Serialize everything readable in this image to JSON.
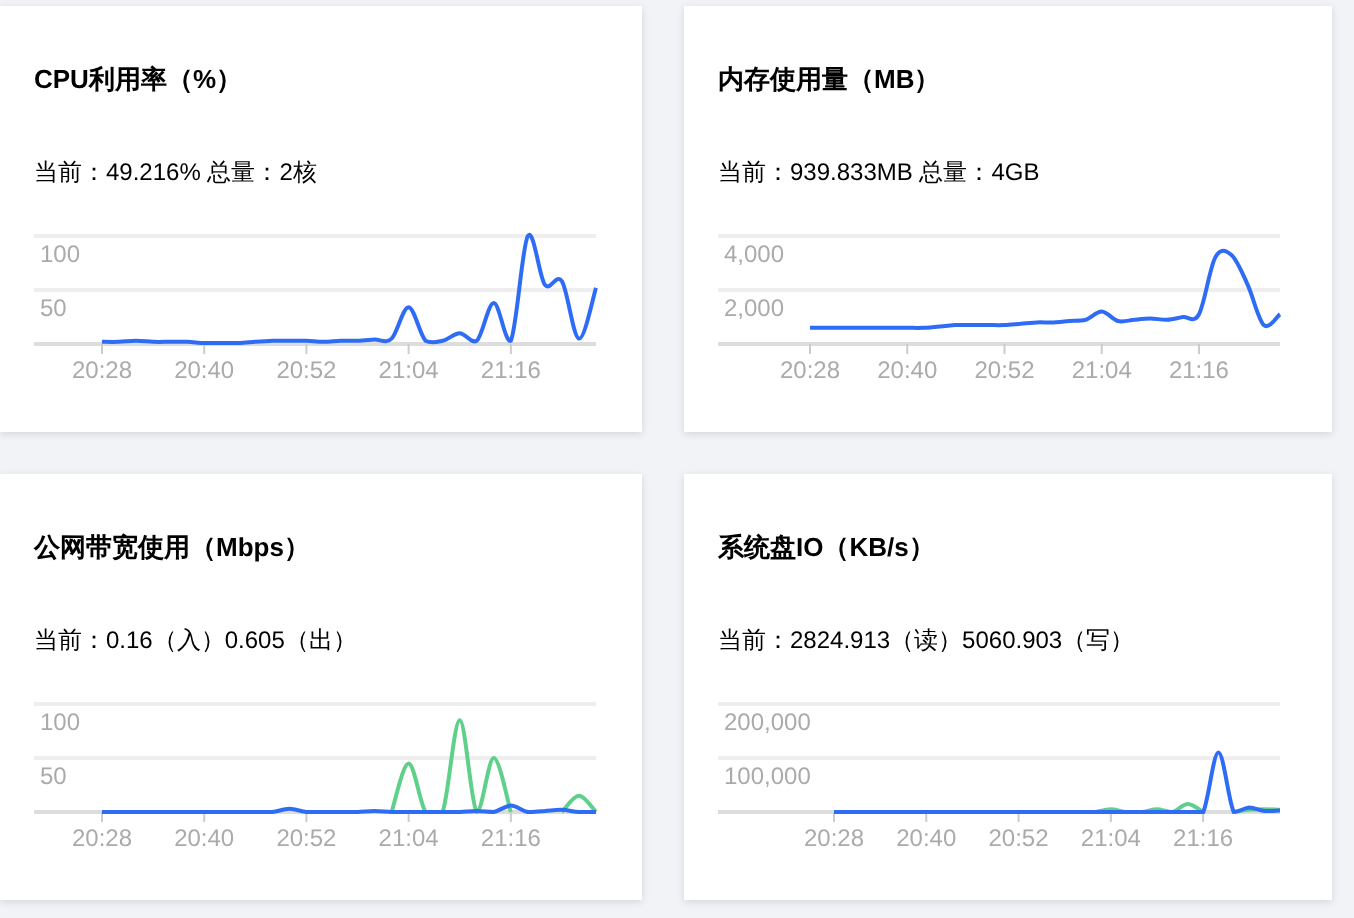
{
  "cards": [
    {
      "title": "CPU利用率（%）",
      "summary": "当前：49.216% 总量：2核",
      "chart_data": {
        "type": "line",
        "categories": [
          "20:28",
          null,
          null,
          null,
          null,
          null,
          "20:40",
          null,
          null,
          null,
          null,
          null,
          "20:52",
          null,
          null,
          null,
          null,
          null,
          "21:04",
          null,
          null,
          null,
          null,
          null,
          "21:16",
          null,
          null,
          null,
          null,
          null
        ],
        "ylim": [
          0,
          100
        ],
        "yticks": [
          {
            "value": 50,
            "label": "50"
          },
          {
            "value": 100,
            "label": "100"
          }
        ],
        "series": [
          {
            "color": "#2e6cf6",
            "values": [
              2,
              2,
              3,
              2,
              2,
              2,
              1,
              1,
              1,
              2,
              3,
              3,
              3,
              2,
              3,
              3,
              4,
              5,
              34,
              3,
              3,
              10,
              3,
              38,
              3,
              100,
              55,
              58,
              5,
              52
            ]
          }
        ]
      }
    },
    {
      "title": "内存使用量（MB）",
      "summary": "当前：939.833MB 总量：4GB",
      "chart_data": {
        "type": "line",
        "categories": [
          "20:28",
          null,
          null,
          null,
          null,
          null,
          "20:40",
          null,
          null,
          null,
          null,
          null,
          "20:52",
          null,
          null,
          null,
          null,
          null,
          "21:04",
          null,
          null,
          null,
          null,
          null,
          "21:16",
          null,
          null,
          null,
          null,
          null
        ],
        "ylim": [
          0,
          4000
        ],
        "yticks": [
          {
            "value": 2000,
            "label": "2,000"
          },
          {
            "value": 4000,
            "label": "4,000"
          }
        ],
        "series": [
          {
            "color": "#2e6cf6",
            "values": [
              600,
              600,
              600,
              600,
              600,
              600,
              600,
              600,
              650,
              700,
              700,
              700,
              700,
              750,
              800,
              800,
              850,
              900,
              1200,
              850,
              900,
              950,
              900,
              1000,
              1100,
              3200,
              3300,
              2200,
              700,
              1100
            ]
          }
        ]
      }
    },
    {
      "title": "公网带宽使用（Mbps）",
      "summary": "当前：0.16（入）0.605（出）",
      "chart_data": {
        "type": "line",
        "categories": [
          "20:28",
          null,
          null,
          null,
          null,
          null,
          "20:40",
          null,
          null,
          null,
          null,
          null,
          "20:52",
          null,
          null,
          null,
          null,
          null,
          "21:04",
          null,
          null,
          null,
          null,
          null,
          "21:16",
          null,
          null,
          null,
          null,
          null
        ],
        "ylim": [
          0,
          100
        ],
        "yticks": [
          {
            "value": 50,
            "label": "50"
          },
          {
            "value": 100,
            "label": "100"
          }
        ],
        "series": [
          {
            "color": "#5fd08a",
            "values": [
              null,
              null,
              null,
              null,
              null,
              null,
              null,
              null,
              null,
              null,
              null,
              null,
              null,
              null,
              null,
              null,
              null,
              0,
              45,
              0,
              0,
              85,
              0,
              50,
              0,
              null,
              null,
              0,
              15,
              0
            ]
          },
          {
            "color": "#2e6cf6",
            "values": [
              0,
              0,
              0,
              0,
              0,
              0,
              0,
              0,
              0,
              0,
              0,
              3,
              0,
              0,
              0,
              0,
              1,
              0,
              0,
              0,
              0,
              0,
              1,
              0,
              6,
              0,
              1,
              2,
              0,
              0
            ]
          }
        ]
      }
    },
    {
      "title": "系统盘IO（KB/s）",
      "summary": "当前：2824.913（读）5060.903（写）",
      "chart_data": {
        "type": "line",
        "categories": [
          "20:28",
          null,
          null,
          null,
          null,
          null,
          "20:40",
          null,
          null,
          null,
          null,
          null,
          "20:52",
          null,
          null,
          null,
          null,
          null,
          "21:04",
          null,
          null,
          null,
          null,
          null,
          "21:16",
          null,
          null,
          null,
          null,
          null
        ],
        "ylim": [
          0,
          200000
        ],
        "yticks": [
          {
            "value": 100000,
            "label": "100,000"
          },
          {
            "value": 200000,
            "label": "200,000"
          }
        ],
        "series": [
          {
            "color": "#5fd08a",
            "values": [
              null,
              null,
              null,
              null,
              null,
              null,
              null,
              null,
              null,
              null,
              null,
              null,
              null,
              null,
              null,
              null,
              null,
              0,
              5000,
              0,
              0,
              5000,
              0,
              15000,
              0,
              null,
              0,
              4000,
              5000,
              4000
            ]
          },
          {
            "color": "#2e6cf6",
            "values": [
              0,
              0,
              0,
              0,
              0,
              0,
              0,
              0,
              0,
              0,
              0,
              0,
              0,
              0,
              0,
              0,
              0,
              0,
              0,
              0,
              0,
              0,
              0,
              0,
              0,
              110000,
              0,
              8000,
              2000,
              3000
            ]
          }
        ]
      }
    }
  ]
}
